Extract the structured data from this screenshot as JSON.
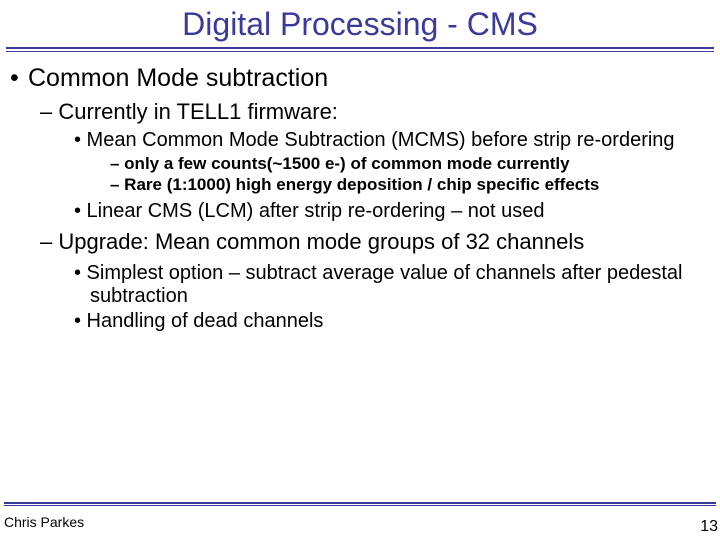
{
  "title": "Digital Processing - CMS",
  "l1": {
    "a": "Common Mode subtraction"
  },
  "l2": {
    "a": "– Currently in TELL1 firmware:",
    "b": "– Upgrade: Mean common mode groups of 32 channels"
  },
  "l3": {
    "a": "• Mean Common Mode Subtraction (MCMS) before strip re-ordering",
    "b": "• Linear CMS (LCM) after strip re-ordering – not used",
    "c": "• Simplest option – subtract average value of channels after pedestal subtraction",
    "d": "• Handling of dead channels"
  },
  "l4": {
    "a": "– only a few counts(~1500 e-) of common mode currently",
    "b": "– Rare (1:1000) high energy deposition / chip specific effects"
  },
  "footer": {
    "author": "Chris Parkes",
    "page": "13"
  }
}
